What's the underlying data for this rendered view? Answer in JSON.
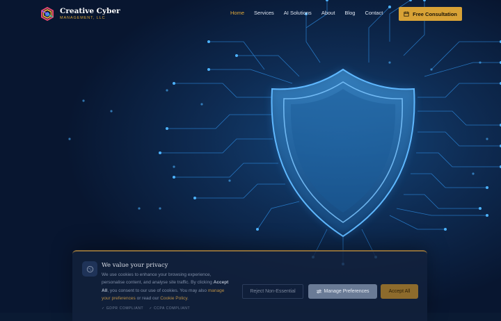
{
  "brand": {
    "name": "Creative Cyber",
    "subtitle": "MANAGEMENT, LLC"
  },
  "nav": {
    "items": [
      {
        "label": "Home",
        "active": true
      },
      {
        "label": "Services",
        "active": false
      },
      {
        "label": "AI Solutions",
        "active": false
      },
      {
        "label": "About",
        "active": false
      },
      {
        "label": "Blog",
        "active": false
      },
      {
        "label": "Contact",
        "active": false
      }
    ]
  },
  "cta": {
    "label": "Free Consultation",
    "icon": "calendar-icon"
  },
  "hero": {
    "icon": "shield-icon",
    "accent": "#3aa8ff"
  },
  "cookie": {
    "title": "We value your privacy",
    "text_part1": "We use cookies to enhance your browsing experience, personalise content, and analyse site traffic. By clicking ",
    "accept_bold": "Accept All",
    "text_part2": ", you consent to our use of cookies. You may also ",
    "manage_link": "manage your preferences",
    "text_part3": " or read our ",
    "policy_link": "Cookie Policy",
    "text_part4": ".",
    "badges": [
      "✓ GDPR COMPLIANT",
      "✓ CCPA COMPLIANT"
    ],
    "buttons": {
      "reject": "Reject Non-Essential",
      "manage": "Manage Preferences",
      "accept": "Accept All"
    }
  },
  "colors": {
    "background": "#0a1a33",
    "gold": "#d8a236",
    "circuit": "#2a8de0"
  }
}
